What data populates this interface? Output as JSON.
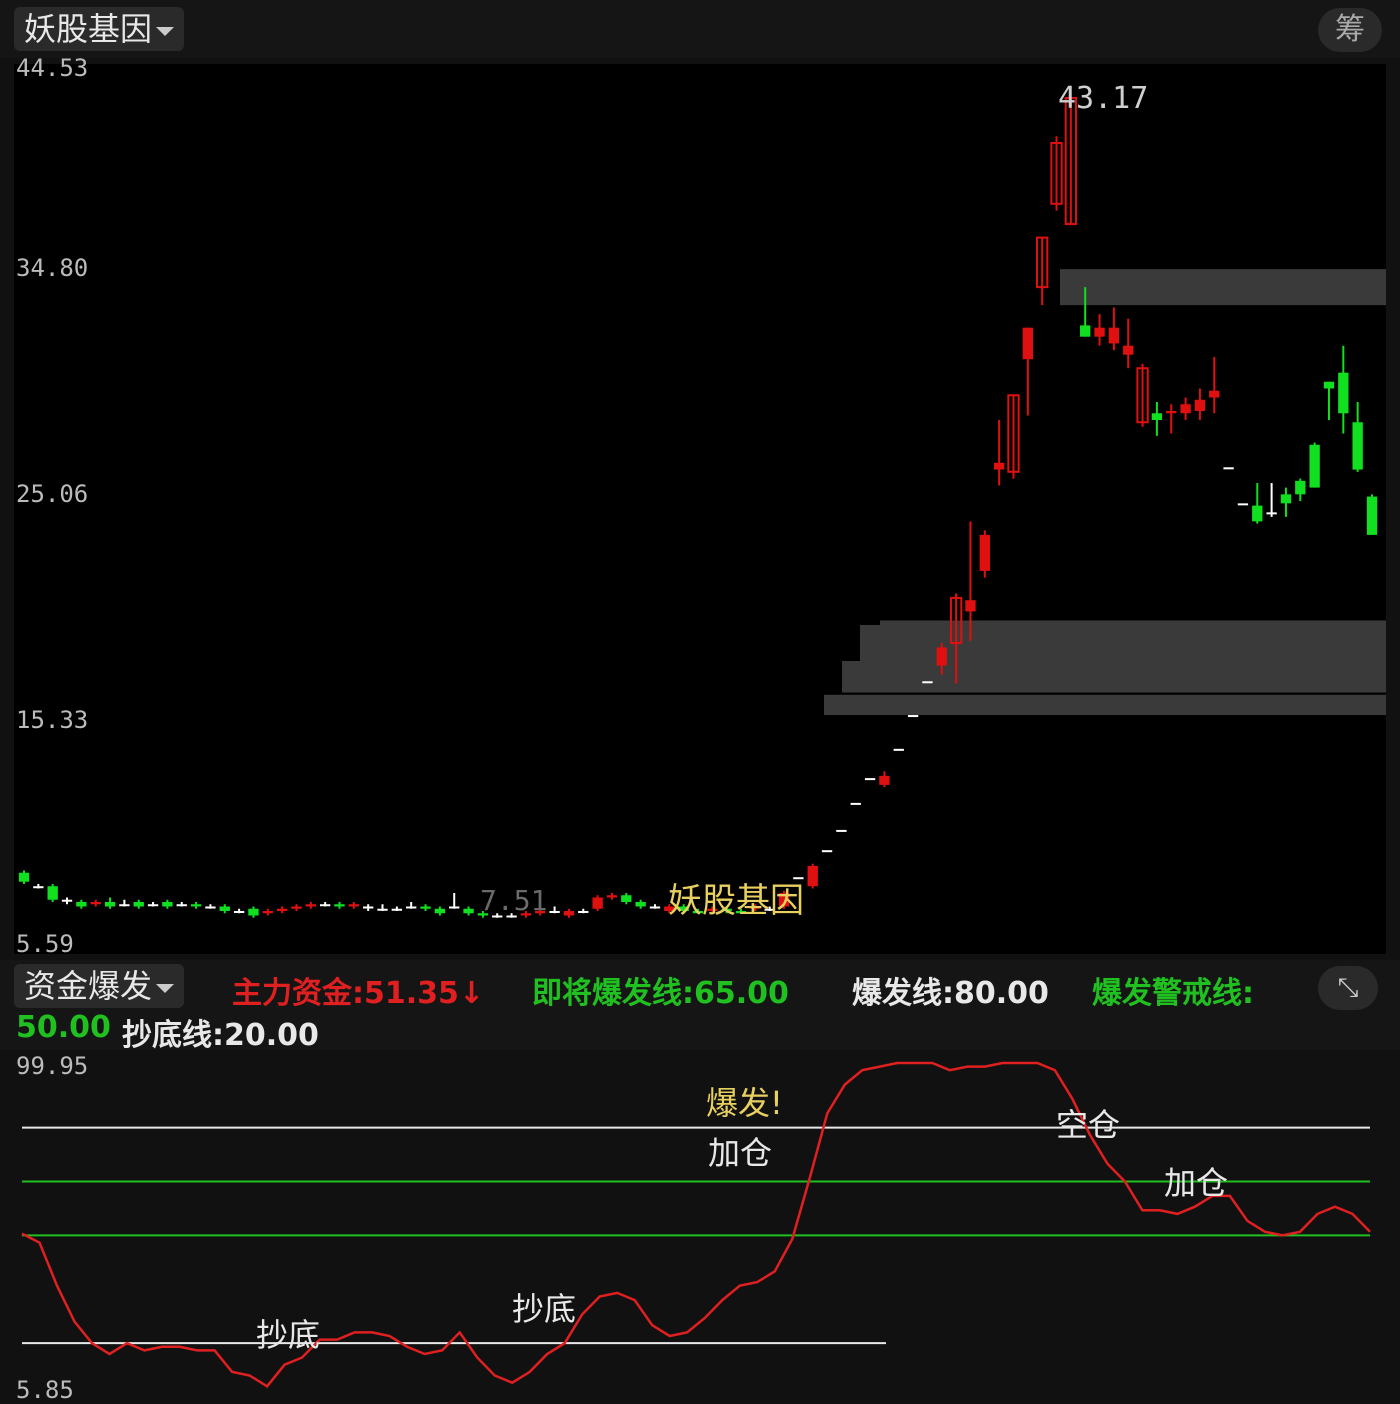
{
  "header": {
    "indicator_name": "妖股基因",
    "chip_button": "筹"
  },
  "main_chart": {
    "y_ticks": [
      "44.53",
      "34.80",
      "25.06",
      "15.33",
      "5.59"
    ],
    "high_label": "43.17",
    "low_label": "7.51",
    "overlay_text": "妖股基因",
    "colors": {
      "up": "#e01010",
      "down": "#10e020",
      "flat": "#ffffff",
      "zone": "#3a3a3a",
      "overlay": "#e8d060"
    }
  },
  "indicator": {
    "name": "资金爆发",
    "items": [
      {
        "label": "主力资金:51.35↓",
        "color": "#e02020"
      },
      {
        "label": "即将爆发线:65.00",
        "color": "#20c020"
      },
      {
        "label": "爆发线:80.00",
        "color": "#e8e8e8"
      },
      {
        "label": "爆发警戒线:",
        "color": "#20c020"
      },
      {
        "label": "50.00",
        "color": "#20c020"
      },
      {
        "label": "抄底线:20.00",
        "color": "#e8e8e8"
      }
    ],
    "y_top": "99.95",
    "y_bottom": "5.85",
    "annotations": [
      "爆发!",
      "加仓",
      "空仓",
      "加仓",
      "抄底",
      "抄底"
    ]
  },
  "chart_data": [
    {
      "type": "candlestick",
      "ylim": [
        5.59,
        44.53
      ],
      "y_ticks": [
        44.53,
        34.8,
        25.06,
        15.33,
        5.59
      ],
      "high": 43.17,
      "low": 7.51,
      "candles": [
        {
          "o": 8.8,
          "c": 8.4,
          "h": 8.9,
          "l": 8.3
        },
        {
          "o": 8.2,
          "c": 8.2,
          "h": 8.3,
          "l": 8.1
        },
        {
          "o": 8.2,
          "c": 7.6,
          "h": 8.3,
          "l": 7.5
        },
        {
          "o": 7.6,
          "c": 7.6,
          "h": 7.7,
          "l": 7.4
        },
        {
          "o": 7.5,
          "c": 7.3,
          "h": 7.6,
          "l": 7.2
        },
        {
          "o": 7.4,
          "c": 7.5,
          "h": 7.6,
          "l": 7.3
        },
        {
          "o": 7.5,
          "c": 7.3,
          "h": 7.7,
          "l": 7.2
        },
        {
          "o": 7.4,
          "c": 7.4,
          "h": 7.6,
          "l": 7.3
        },
        {
          "o": 7.5,
          "c": 7.3,
          "h": 7.6,
          "l": 7.2
        },
        {
          "o": 7.4,
          "c": 7.4,
          "h": 7.5,
          "l": 7.3
        },
        {
          "o": 7.5,
          "c": 7.3,
          "h": 7.6,
          "l": 7.2
        },
        {
          "o": 7.4,
          "c": 7.4,
          "h": 7.5,
          "l": 7.3
        },
        {
          "o": 7.4,
          "c": 7.3,
          "h": 7.5,
          "l": 7.2
        },
        {
          "o": 7.3,
          "c": 7.3,
          "h": 7.4,
          "l": 7.2
        },
        {
          "o": 7.3,
          "c": 7.1,
          "h": 7.4,
          "l": 7.0
        },
        {
          "o": 7.1,
          "c": 7.1,
          "h": 7.2,
          "l": 7.0
        },
        {
          "o": 7.2,
          "c": 6.9,
          "h": 7.3,
          "l": 6.8
        },
        {
          "o": 7.0,
          "c": 7.1,
          "h": 7.2,
          "l": 6.9
        },
        {
          "o": 7.1,
          "c": 7.2,
          "h": 7.3,
          "l": 7.0
        },
        {
          "o": 7.2,
          "c": 7.3,
          "h": 7.4,
          "l": 7.1
        },
        {
          "o": 7.3,
          "c": 7.4,
          "h": 7.5,
          "l": 7.2
        },
        {
          "o": 7.4,
          "c": 7.4,
          "h": 7.5,
          "l": 7.3
        },
        {
          "o": 7.4,
          "c": 7.3,
          "h": 7.5,
          "l": 7.2
        },
        {
          "o": 7.3,
          "c": 7.4,
          "h": 7.5,
          "l": 7.2
        },
        {
          "o": 7.3,
          "c": 7.3,
          "h": 7.4,
          "l": 7.1
        },
        {
          "o": 7.2,
          "c": 7.2,
          "h": 7.4,
          "l": 7.1
        },
        {
          "o": 7.2,
          "c": 7.2,
          "h": 7.3,
          "l": 7.1
        },
        {
          "o": 7.3,
          "c": 7.3,
          "h": 7.5,
          "l": 7.2
        },
        {
          "o": 7.3,
          "c": 7.2,
          "h": 7.4,
          "l": 7.1
        },
        {
          "o": 7.2,
          "c": 7.0,
          "h": 7.3,
          "l": 6.9
        },
        {
          "o": 7.3,
          "c": 7.3,
          "h": 7.9,
          "l": 7.2
        },
        {
          "o": 7.2,
          "c": 7.0,
          "h": 7.3,
          "l": 6.9
        },
        {
          "o": 7.0,
          "c": 6.9,
          "h": 7.1,
          "l": 6.8
        },
        {
          "o": 6.9,
          "c": 6.9,
          "h": 7.0,
          "l": 6.8
        },
        {
          "o": 6.9,
          "c": 6.9,
          "h": 7.0,
          "l": 6.8
        },
        {
          "o": 6.9,
          "c": 7.0,
          "h": 7.1,
          "l": 6.8
        },
        {
          "o": 7.0,
          "c": 7.1,
          "h": 7.2,
          "l": 6.9
        },
        {
          "o": 7.1,
          "c": 7.1,
          "h": 7.3,
          "l": 7.0
        },
        {
          "o": 6.9,
          "c": 7.1,
          "h": 7.2,
          "l": 6.8
        },
        {
          "o": 7.1,
          "c": 7.1,
          "h": 7.2,
          "l": 7.0
        },
        {
          "o": 7.2,
          "c": 7.7,
          "h": 7.8,
          "l": 7.1
        },
        {
          "o": 7.7,
          "c": 7.8,
          "h": 7.9,
          "l": 7.6
        },
        {
          "o": 7.8,
          "c": 7.5,
          "h": 7.9,
          "l": 7.4
        },
        {
          "o": 7.5,
          "c": 7.3,
          "h": 7.6,
          "l": 7.2
        },
        {
          "o": 7.3,
          "c": 7.3,
          "h": 7.4,
          "l": 7.2
        },
        {
          "o": 7.1,
          "c": 7.3,
          "h": 7.4,
          "l": 7.0
        },
        {
          "o": 7.3,
          "c": 7.1,
          "h": 7.4,
          "l": 7.0
        },
        {
          "o": 7.1,
          "c": 7.0,
          "h": 7.2,
          "l": 7.0
        },
        {
          "o": 7.1,
          "c": 7.2,
          "h": 7.3,
          "l": 7.0
        },
        {
          "o": 7.2,
          "c": 7.1,
          "h": 7.3,
          "l": 7.0
        },
        {
          "o": 7.1,
          "c": 7.0,
          "h": 7.2,
          "l": 7.0
        },
        {
          "o": 7.2,
          "c": 7.3,
          "h": 7.4,
          "l": 7.1
        },
        {
          "o": 7.2,
          "c": 7.2,
          "h": 7.3,
          "l": 7.1
        },
        {
          "o": 7.3,
          "c": 7.9,
          "h": 8.0,
          "l": 7.2
        },
        {
          "o": 8.6,
          "c": 8.6,
          "h": 8.6,
          "l": 8.6
        },
        {
          "o": 8.2,
          "c": 9.1,
          "h": 9.2,
          "l": 8.1
        },
        {
          "o": 9.8,
          "c": 9.8,
          "h": 9.8,
          "l": 9.8
        },
        {
          "o": 10.7,
          "c": 10.7,
          "h": 10.7,
          "l": 10.7
        },
        {
          "o": 11.9,
          "c": 11.9,
          "h": 11.9,
          "l": 11.9
        },
        {
          "o": 13.0,
          "c": 13.0,
          "h": 13.0,
          "l": 13.0
        },
        {
          "o": 12.7,
          "c": 13.1,
          "h": 13.3,
          "l": 12.6
        },
        {
          "o": 14.3,
          "c": 14.3,
          "h": 14.3,
          "l": 14.3
        },
        {
          "o": 15.8,
          "c": 15.8,
          "h": 15.8,
          "l": 15.8
        },
        {
          "o": 17.3,
          "c": 17.3,
          "h": 17.3,
          "l": 17.3
        },
        {
          "o": 18.0,
          "c": 18.8,
          "h": 19.0,
          "l": 17.6
        },
        {
          "o": 19.0,
          "c": 21.0,
          "h": 21.2,
          "l": 17.2
        },
        {
          "o": 20.4,
          "c": 20.9,
          "h": 24.4,
          "l": 19.1
        },
        {
          "o": 22.2,
          "c": 23.8,
          "h": 24.0,
          "l": 21.9
        },
        {
          "o": 26.7,
          "c": 27.0,
          "h": 28.9,
          "l": 26.0
        },
        {
          "o": 26.6,
          "c": 30.0,
          "h": 30.0,
          "l": 26.3
        },
        {
          "o": 31.6,
          "c": 33.0,
          "h": 33.0,
          "l": 29.1
        },
        {
          "o": 34.8,
          "c": 37.0,
          "h": 37.0,
          "l": 34.0
        },
        {
          "o": 38.5,
          "c": 41.2,
          "h": 41.5,
          "l": 38.2
        },
        {
          "o": 37.6,
          "c": 43.2,
          "h": 43.2,
          "l": 37.6
        },
        {
          "o": 33.1,
          "c": 32.6,
          "h": 34.8,
          "l": 32.6
        },
        {
          "o": 32.6,
          "c": 33.0,
          "h": 33.6,
          "l": 32.2
        },
        {
          "o": 32.3,
          "c": 33.0,
          "h": 33.9,
          "l": 32.0
        },
        {
          "o": 31.8,
          "c": 32.2,
          "h": 33.4,
          "l": 31.2
        },
        {
          "o": 28.8,
          "c": 31.2,
          "h": 31.4,
          "l": 28.6
        },
        {
          "o": 29.2,
          "c": 28.9,
          "h": 29.7,
          "l": 28.2
        },
        {
          "o": 29.2,
          "c": 29.3,
          "h": 29.6,
          "l": 28.3
        },
        {
          "o": 29.2,
          "c": 29.6,
          "h": 29.9,
          "l": 28.9
        },
        {
          "o": 29.3,
          "c": 29.8,
          "h": 30.3,
          "l": 28.9
        },
        {
          "o": 29.9,
          "c": 30.2,
          "h": 31.7,
          "l": 29.2
        },
        {
          "o": 26.8,
          "c": 26.8,
          "h": 26.8,
          "l": 26.8
        },
        {
          "o": 25.2,
          "c": 25.2,
          "h": 25.2,
          "l": 25.2
        },
        {
          "o": 25.1,
          "c": 24.4,
          "h": 26.1,
          "l": 24.3
        },
        {
          "o": 24.8,
          "c": 24.8,
          "h": 26.1,
          "l": 24.6
        },
        {
          "o": 25.6,
          "c": 25.2,
          "h": 25.9,
          "l": 24.6
        },
        {
          "o": 26.2,
          "c": 25.6,
          "h": 26.3,
          "l": 25.3
        },
        {
          "o": 27.8,
          "c": 25.9,
          "h": 27.9,
          "l": 25.9
        },
        {
          "o": 30.6,
          "c": 30.3,
          "h": 30.6,
          "l": 28.9
        },
        {
          "o": 31.0,
          "c": 29.2,
          "h": 32.2,
          "l": 28.3
        },
        {
          "o": 28.8,
          "c": 26.7,
          "h": 29.7,
          "l": 26.6
        },
        {
          "o": 25.5,
          "c": 23.8,
          "h": 25.6,
          "l": 23.8
        }
      ],
      "support_zones": [
        [
          34.0,
          35.6
        ],
        [
          19.8,
          20.0
        ],
        [
          18.2,
          19.8
        ],
        [
          16.8,
          18.2
        ],
        [
          15.8,
          16.7
        ]
      ]
    },
    {
      "type": "line",
      "ylim": [
        5.85,
        99.95
      ],
      "series": [
        {
          "values": [
            50.5,
            48,
            36,
            26,
            20,
            17,
            20,
            18,
            19,
            19,
            18,
            18,
            12,
            11,
            8,
            14,
            16,
            21,
            21,
            23,
            23,
            22,
            19,
            17,
            18,
            23,
            16,
            11,
            9,
            12,
            17,
            20,
            28,
            33,
            34,
            32,
            25,
            22,
            23,
            27,
            32,
            36,
            37,
            40,
            49,
            66,
            84,
            92,
            96,
            97,
            98,
            98,
            98,
            96,
            97,
            97,
            98,
            98,
            98,
            96,
            88,
            78,
            70,
            65,
            57,
            57,
            56,
            58,
            61,
            61,
            54,
            51,
            50,
            51,
            56,
            58,
            56,
            51
          ]
        }
      ],
      "hlines": [
        80,
        65,
        50,
        20
      ],
      "annotations": [
        "爆发!",
        "加仓",
        "空仓",
        "加仓",
        "抄底",
        "抄底"
      ]
    }
  ]
}
